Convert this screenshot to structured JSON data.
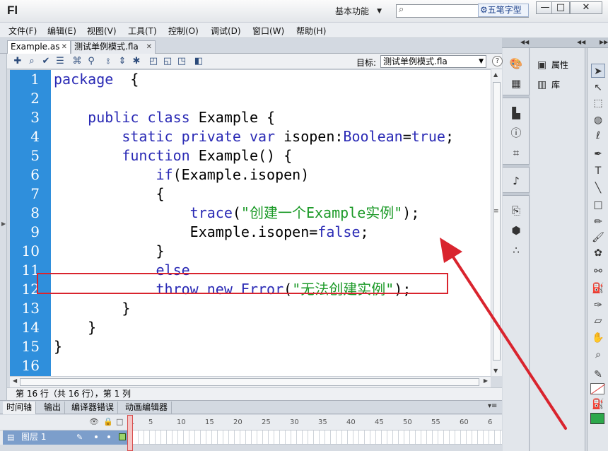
{
  "app": {
    "logo": "Fl",
    "workspace": "基本功能",
    "ime_label": "五笔字型",
    "window_buttons": {
      "minimize": "—",
      "maximize": "□",
      "close": "✕"
    }
  },
  "menu": [
    "文件(F)",
    "编辑(E)",
    "视图(V)",
    "工具(T)",
    "控制(O)",
    "调试(D)",
    "窗口(W)",
    "帮助(H)"
  ],
  "doc_tabs": [
    {
      "label": "Example.as",
      "active": true
    },
    {
      "label": "测试单例模式.fla",
      "active": false
    }
  ],
  "code_toolbar": {
    "target_label": "目标:",
    "target_value": "测试单例模式.fla",
    "help": "?"
  },
  "editor": {
    "line_numbers": [
      "1",
      "2",
      "3",
      "4",
      "5",
      "6",
      "7",
      "8",
      "9",
      "10",
      "11",
      "12",
      "13",
      "14",
      "15",
      "16"
    ],
    "lines": [
      [
        {
          "t": "package",
          "c": "kw"
        },
        {
          "t": "  {",
          "c": ""
        }
      ],
      [],
      [
        {
          "t": "    ",
          "c": ""
        },
        {
          "t": "public",
          "c": "kw"
        },
        {
          "t": " ",
          "c": ""
        },
        {
          "t": "class",
          "c": "kw"
        },
        {
          "t": " Example {",
          "c": ""
        }
      ],
      [
        {
          "t": "        ",
          "c": ""
        },
        {
          "t": "static",
          "c": "kw"
        },
        {
          "t": " ",
          "c": ""
        },
        {
          "t": "private",
          "c": "kw"
        },
        {
          "t": " ",
          "c": ""
        },
        {
          "t": "var",
          "c": "kw"
        },
        {
          "t": " isopen:",
          "c": ""
        },
        {
          "t": "Boolean",
          "c": "kw"
        },
        {
          "t": "=",
          "c": ""
        },
        {
          "t": "true",
          "c": "kw"
        },
        {
          "t": ";",
          "c": ""
        }
      ],
      [
        {
          "t": "        ",
          "c": ""
        },
        {
          "t": "function",
          "c": "kw"
        },
        {
          "t": " Example() {",
          "c": ""
        }
      ],
      [
        {
          "t": "            ",
          "c": ""
        },
        {
          "t": "if",
          "c": "kw"
        },
        {
          "t": "(Example.isopen)",
          "c": ""
        }
      ],
      [
        {
          "t": "            {",
          "c": ""
        }
      ],
      [
        {
          "t": "                ",
          "c": ""
        },
        {
          "t": "trace",
          "c": "kw"
        },
        {
          "t": "(",
          "c": ""
        },
        {
          "t": "\"创建一个Example实例\"",
          "c": "str"
        },
        {
          "t": ");",
          "c": ""
        }
      ],
      [
        {
          "t": "                Example.isopen=",
          "c": ""
        },
        {
          "t": "false",
          "c": "kw"
        },
        {
          "t": ";",
          "c": ""
        }
      ],
      [
        {
          "t": "            }",
          "c": ""
        }
      ],
      [
        {
          "t": "            ",
          "c": ""
        },
        {
          "t": "else",
          "c": "kw"
        }
      ],
      [
        {
          "t": "            ",
          "c": ""
        },
        {
          "t": "throw",
          "c": "kw"
        },
        {
          "t": " ",
          "c": ""
        },
        {
          "t": "new",
          "c": "kw"
        },
        {
          "t": " ",
          "c": ""
        },
        {
          "t": "Error",
          "c": "kw"
        },
        {
          "t": "(",
          "c": ""
        },
        {
          "t": "\"无法创建实例\"",
          "c": "str"
        },
        {
          "t": ");",
          "c": ""
        }
      ],
      [
        {
          "t": "        }",
          "c": ""
        }
      ],
      [
        {
          "t": "    }",
          "c": ""
        }
      ],
      [
        {
          "t": "}",
          "c": ""
        }
      ],
      []
    ],
    "highlighted_line": "8"
  },
  "status_line": "第 16 行（共 16 行），第 1 列",
  "bottom_tabs": [
    "时间轴",
    "输出",
    "编译器错误",
    "动画编辑器"
  ],
  "timeline": {
    "ruler": [
      "1",
      "5",
      "10",
      "15",
      "20",
      "25",
      "30",
      "35",
      "40",
      "45",
      "50",
      "55",
      "60",
      "6"
    ],
    "layer_name": "图层 1"
  },
  "right_panel": {
    "properties_label": "属性",
    "library_label": "库"
  },
  "colors": {
    "gutter": "#2f8fdc",
    "keyword": "#2a2ab5",
    "string": "#1c9a28",
    "annotation": "#d9242e"
  }
}
